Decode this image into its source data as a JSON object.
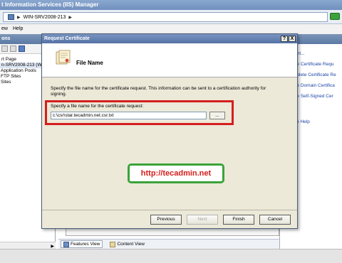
{
  "window": {
    "title": "t Information Services (IIS) Manager"
  },
  "address": {
    "server": "WIN-SRV2008-213"
  },
  "menu": {
    "items": [
      "ew",
      "Help"
    ]
  },
  "left_pane": {
    "header": "ons",
    "tree": [
      "rt Page",
      "n-SRV2008-213 (WI",
      "Application Pools",
      "FTP Sites",
      "Sites"
    ]
  },
  "right_pane": {
    "links": [
      "port...",
      "ate Certificate Requ",
      "mplete Certificate Re",
      "ate Domain Certifica",
      "ate Self-Signed Cer",
      "p",
      "ine Help"
    ]
  },
  "bottom_bar": {
    "features_view": "Features View",
    "content_view": "Content View"
  },
  "dialog": {
    "title": "Request Certificate",
    "help_btn": "?",
    "close_btn": "X",
    "banner_title": "File Name",
    "description": "Specify the file name for the certificate request. This information can be sent to a certification authority for signing.",
    "field_label": "Specify a file name for the certificate request:",
    "file_name": "c:\\csr\\star.tecadmin.net.csr.txt",
    "browse_label": "...",
    "buttons": {
      "previous": "Previous",
      "next": "Next",
      "finish": "Finish",
      "cancel": "Cancel"
    }
  },
  "watermark": {
    "text": "http://tecadmin.net"
  }
}
